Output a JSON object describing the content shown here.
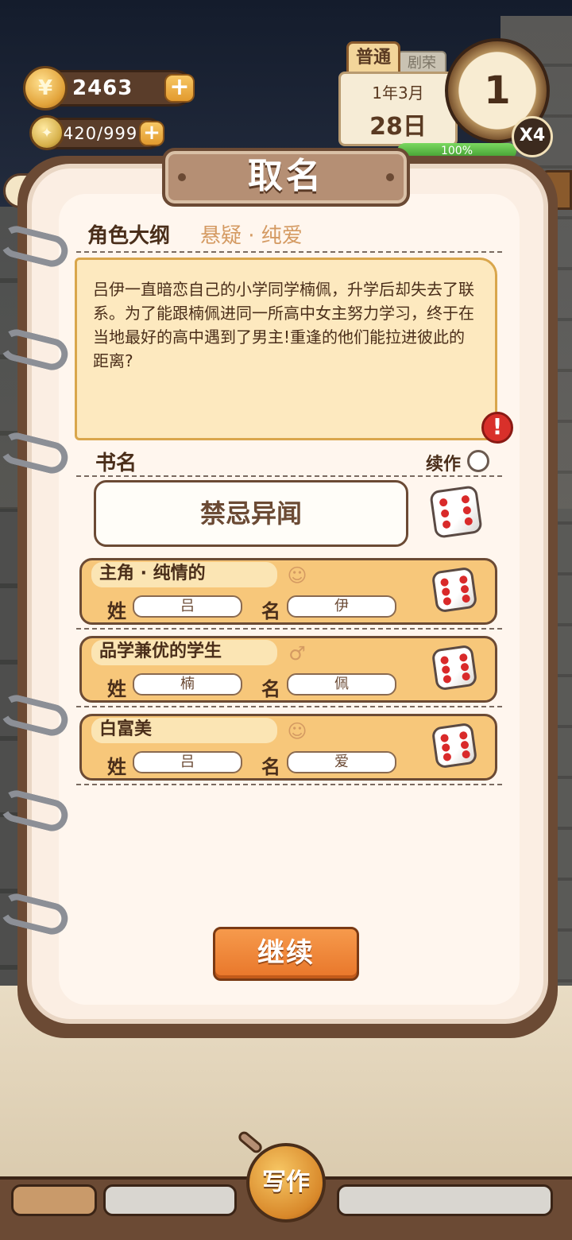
{
  "hud": {
    "coins": "2463",
    "energy": "420/999",
    "mode_tab": "普通",
    "mode_tab_2": "剧荣",
    "date_month": "1年3月",
    "date_day": "28日",
    "clock_value": "1",
    "speed": "X4",
    "progress_text": "100%",
    "progress": 1.0,
    "plus_symbol": "+",
    "coin_symbol": "¥"
  },
  "dialog": {
    "title": "取名",
    "outline_label": "角色大纲",
    "outline_genre": "悬疑 · 纯爱",
    "synopsis": "吕伊一直暗恋自己的小学同学楠佩，升学后却失去了联系。为了能跟楠佩进同一所高中女主努力学习，终于在当地最好的高中遇到了男主!重逢的他们能拉进彼此的距离?",
    "alert_symbol": "!",
    "book_label": "书名",
    "sequel_label": "续作",
    "book_name": "禁忌异闻",
    "continue_label": "继续"
  },
  "characters": [
    {
      "tag": "主角 · 纯情的",
      "gender_icon": "female-icon",
      "gender_glyph": "☺",
      "surname_label": "姓",
      "surname": "吕",
      "given_label": "名",
      "given": "伊"
    },
    {
      "tag": "品学兼优的学生",
      "gender_icon": "male-icon",
      "gender_glyph": "♂",
      "surname_label": "姓",
      "surname": "楠",
      "given_label": "名",
      "given": "佩"
    },
    {
      "tag": "白富美",
      "gender_icon": "female-icon",
      "gender_glyph": "☺",
      "surname_label": "姓",
      "surname": "吕",
      "given_label": "名",
      "given": "爱"
    }
  ],
  "bottom_nav": {
    "write_label": "写作"
  },
  "colors": {
    "accent": "#e8762a",
    "card": "#f7c77a",
    "brown": "#6b4a34"
  }
}
